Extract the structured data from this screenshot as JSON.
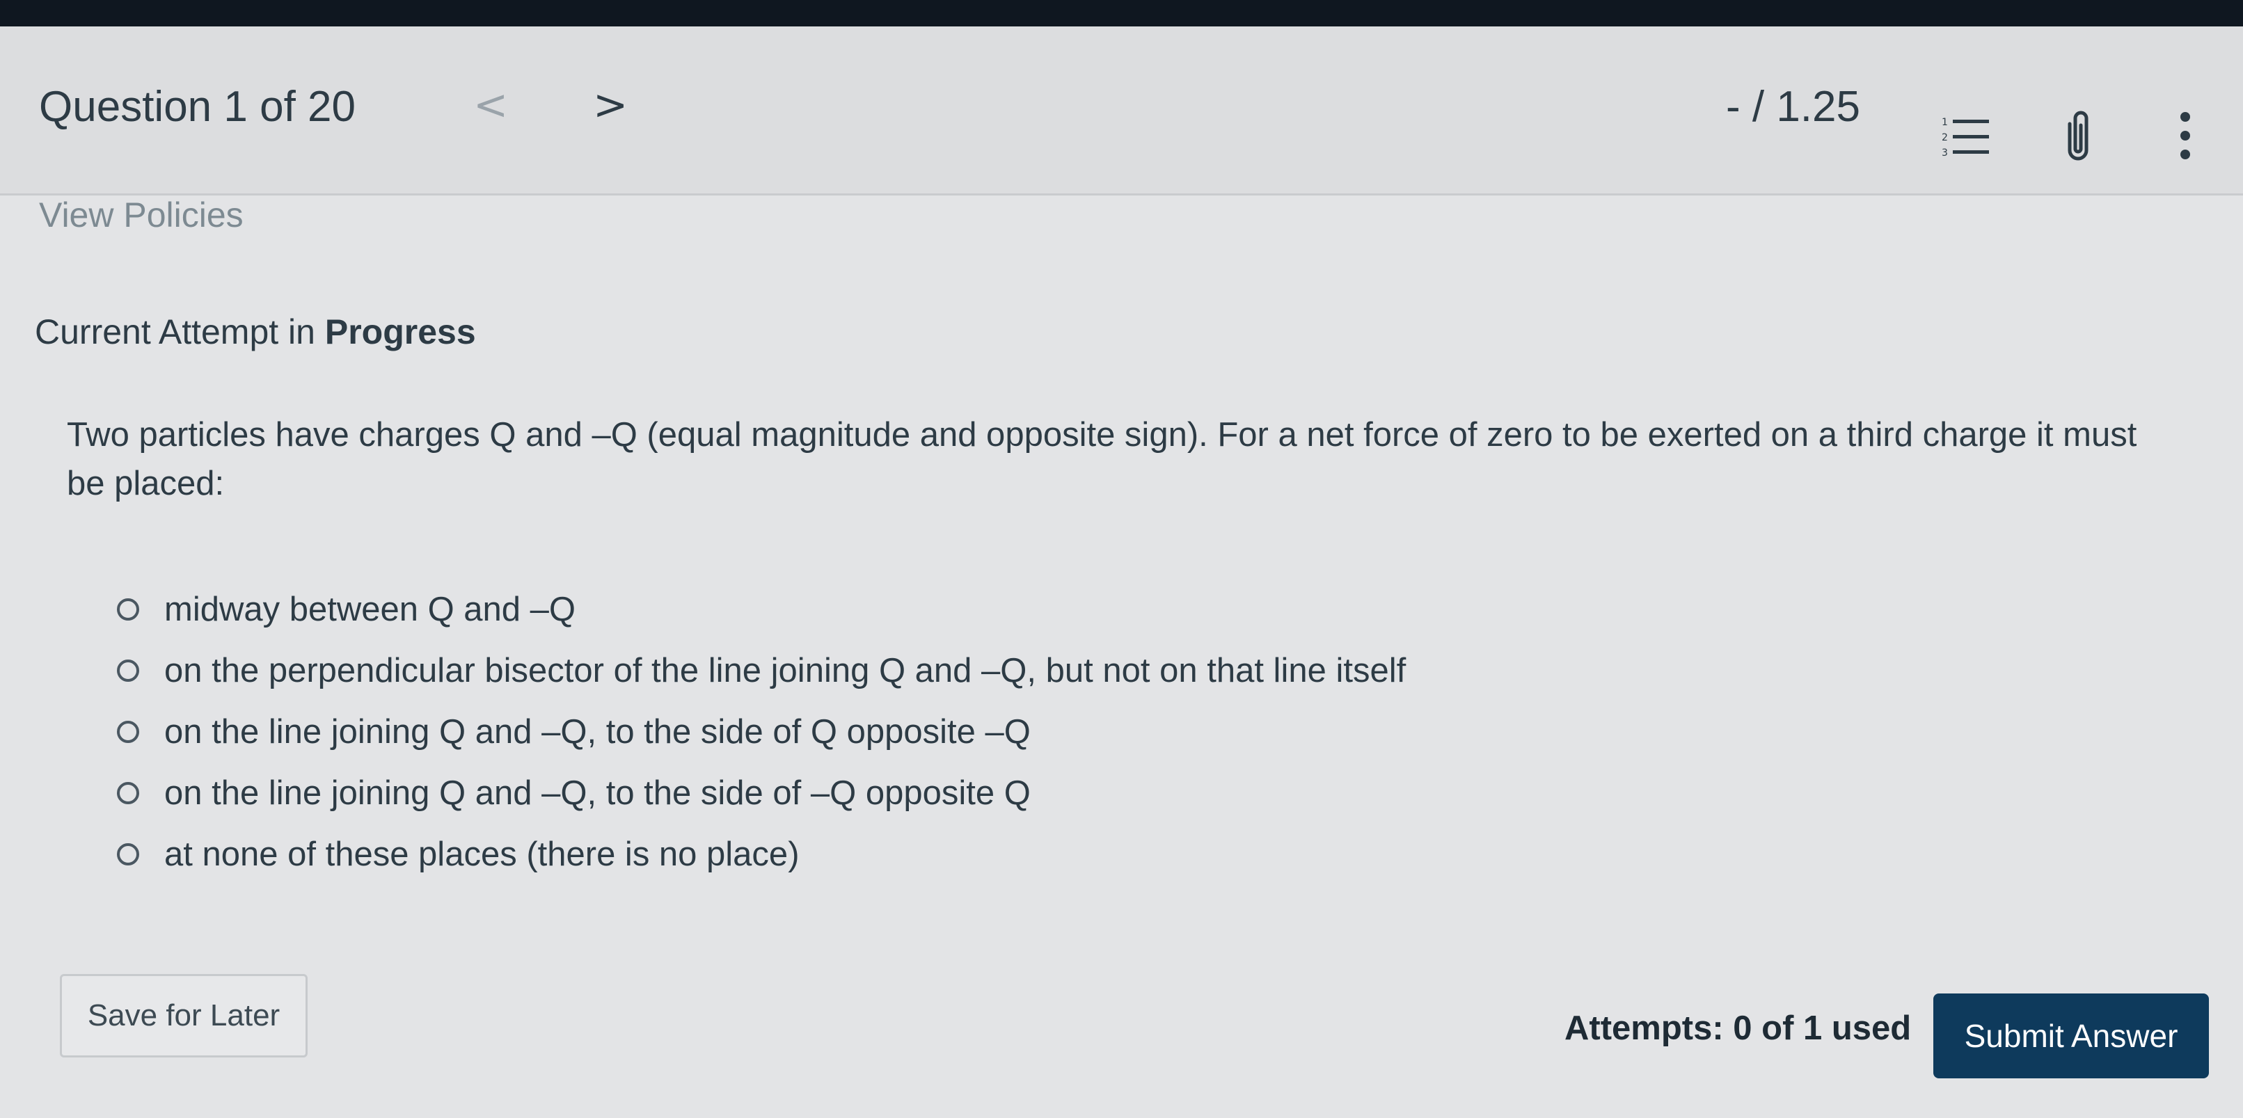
{
  "header": {
    "question_label": "Question 1 of 20",
    "prev_glyph": "<",
    "next_glyph": ">",
    "score": "- / 1.25",
    "icons": [
      "list-icon",
      "paperclip-icon",
      "more-vertical-icon"
    ]
  },
  "policies_link": "View Policies",
  "attempt_status": {
    "prefix": "Current Attempt in ",
    "emphasis": "Progress"
  },
  "question": {
    "text": "Two particles have charges Q and –Q (equal magnitude and opposite sign). For a net force of zero to be exerted on a third charge it must be placed:",
    "options": [
      "midway between Q and –Q",
      "on the perpendicular bisector of the line joining Q and –Q, but not on that line itself",
      "on the line joining Q and –Q, to the side of Q opposite –Q",
      "on the line joining Q and –Q, to the side of –Q opposite Q",
      "at none of these places (there is no place)"
    ]
  },
  "footer": {
    "save_label": "Save for Later",
    "attempts_label": "Attempts: 0 of 1 used",
    "submit_label": "Submit Answer"
  },
  "colors": {
    "submit_bg": "#0e3a5c",
    "text": "#2d3b45",
    "background": "#e3e4e6"
  }
}
